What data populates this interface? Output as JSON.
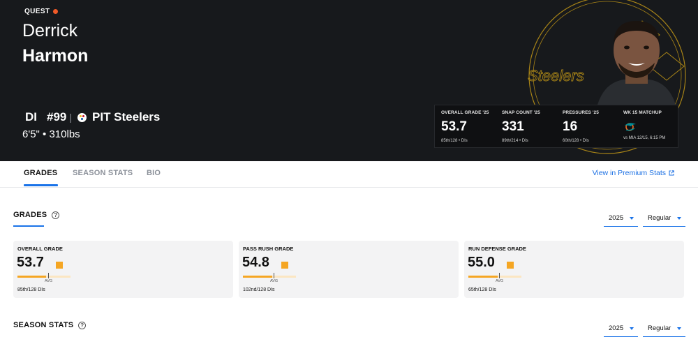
{
  "hero": {
    "quest_label": "QUEST",
    "first_name": "Derrick",
    "last_name": "Harmon",
    "position": "DI",
    "jersey": "#99",
    "separator": "|",
    "team": "PIT Steelers",
    "size": "6'5\" • 310lbs",
    "watermark_text": "Steelers",
    "colors": {
      "background": "#17191c",
      "accent_gold": "#f2b81c",
      "quest_dot": "#f05a28"
    }
  },
  "stats_panel": [
    {
      "label": "OVERALL GRADE '25",
      "value": "53.7",
      "sub": "85th/128 • DIs"
    },
    {
      "label": "SNAP COUNT '25",
      "value": "331",
      "sub": "89th/214 • DIs"
    },
    {
      "label": "PRESSURES '25",
      "value": "16",
      "sub": "60th/128 • DIs"
    },
    {
      "label": "WK 15 MATCHUP",
      "icon": "dolphins-logo-icon",
      "sub": "vs MIA 12/15, 6:15 PM"
    }
  ],
  "tabs": {
    "items": [
      {
        "label": "GRADES",
        "active": true
      },
      {
        "label": "SEASON STATS",
        "active": false
      },
      {
        "label": "BIO",
        "active": false
      }
    ],
    "premium_link": "View in Premium Stats"
  },
  "grades": {
    "title": "GRADES",
    "help": "?",
    "year_select": "2025",
    "type_select": "Regular",
    "avg_label": "AVG",
    "cards": [
      {
        "label": "OVERALL GRADE",
        "value": "53.7",
        "rank": "85th/128 DIs",
        "fill_pct": 53.7
      },
      {
        "label": "PASS RUSH GRADE",
        "value": "54.8",
        "rank": "102nd/128 DIs",
        "fill_pct": 54.8
      },
      {
        "label": "RUN DEFENSE GRADE",
        "value": "55.0",
        "rank": "65th/128 DIs",
        "fill_pct": 55.0
      }
    ],
    "grade_color": "#f5a623"
  },
  "season_stats": {
    "title": "SEASON STATS",
    "help": "?",
    "year_select": "2025",
    "type_select": "Regular"
  }
}
